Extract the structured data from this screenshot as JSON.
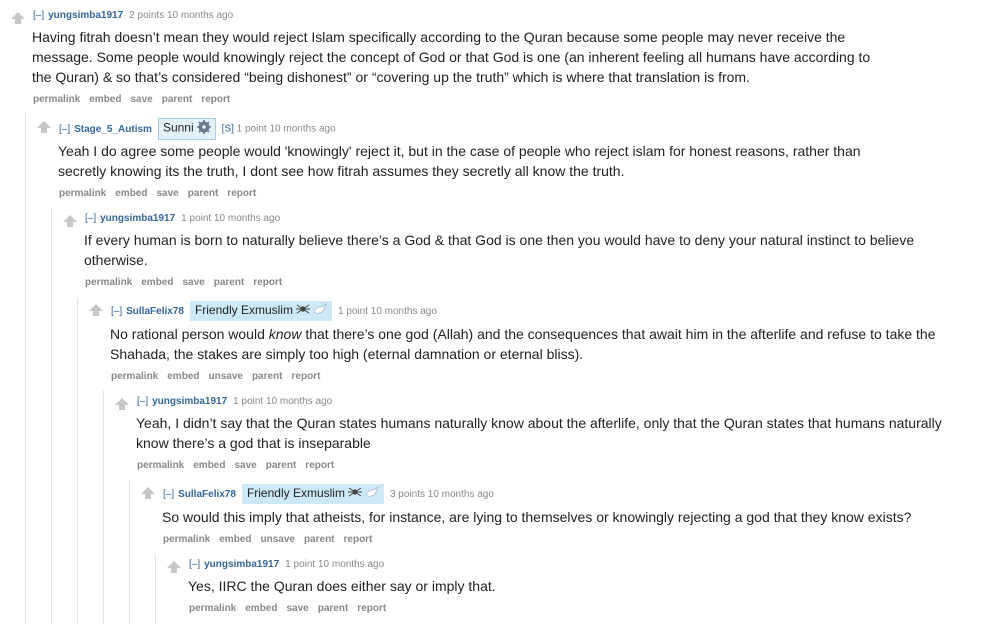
{
  "icons": {
    "upvote": "upvote-arrow-icon",
    "sunni_flair": "gear-emblem-icon",
    "friendly_flair": [
      "spider-icon",
      "dove-icon"
    ]
  },
  "colors": {
    "author": "#336699",
    "meta": "#888888",
    "friendly_flair_bg": "#cde8f7",
    "sunni_flair_bg": "#e3f1f8"
  },
  "comments": [
    {
      "expand": "[–]",
      "author": "yungsimba1917",
      "score": "2 points",
      "time": "10 months ago",
      "body": "Having fitrah doesn’t mean they would reject Islam specifically according to the Quran because some people may never receive the message. Some people would knowingly reject the concept of God or that God is one (an inherent feeling all humans have according to the Quran) & so that’s considered “being dishonest” or “covering up the truth” which is where that translation is from.",
      "buttons": [
        "permalink",
        "embed",
        "save",
        "parent",
        "report"
      ]
    },
    {
      "expand": "[–]",
      "author": "Stage_5_Autism",
      "flair": "Sunni",
      "sub": "[S]",
      "score": "1 point",
      "time": "10 months ago",
      "body": "Yeah I do agree some people would 'knowingly' reject it, but in the case of people who reject islam for honest reasons, rather than secretly knowing its the truth, I dont see how fitrah assumes they secretly all know the truth.",
      "buttons": [
        "permalink",
        "embed",
        "save",
        "parent",
        "report"
      ]
    },
    {
      "expand": "[–]",
      "author": "yungsimba1917",
      "score": "1 point",
      "time": "10 months ago",
      "body": "If every human is born to naturally believe there’s a God & that God is one then you would have to deny your natural instinct to believe otherwise.",
      "buttons": [
        "permalink",
        "embed",
        "save",
        "parent",
        "report"
      ]
    },
    {
      "expand": "[–]",
      "author": "SullaFelix78",
      "flair": "Friendly Exmuslim",
      "score": "1 point",
      "time": "10 months ago",
      "body_pre": "No rational person would ",
      "body_em": "know",
      "body_post": " that there’s one god (Allah) and the consequences that await him in the afterlife and refuse to take the Shahada, the stakes are simply too high (eternal damnation or eternal bliss).",
      "buttons": [
        "permalink",
        "embed",
        "unsave",
        "parent",
        "report"
      ]
    },
    {
      "expand": "[–]",
      "author": "yungsimba1917",
      "score": "1 point",
      "time": "10 months ago",
      "body": "Yeah, I didn’t say that the Quran states humans naturally know about the afterlife, only that the Quran states that humans naturally know there’s a god that is inseparable",
      "buttons": [
        "permalink",
        "embed",
        "save",
        "parent",
        "report"
      ]
    },
    {
      "expand": "[–]",
      "author": "SullaFelix78",
      "flair": "Friendly Exmuslim",
      "score": "3 points",
      "time": "10 months ago",
      "body": "So would this imply that atheists, for instance, are lying to themselves or knowingly rejecting a god that they know exists?",
      "buttons": [
        "permalink",
        "embed",
        "unsave",
        "parent",
        "report"
      ]
    },
    {
      "expand": "[–]",
      "author": "yungsimba1917",
      "score": "1 point",
      "time": "10 months ago",
      "body": "Yes, IIRC the Quran does either say or imply that.",
      "buttons": [
        "permalink",
        "embed",
        "save",
        "parent",
        "report"
      ]
    }
  ]
}
